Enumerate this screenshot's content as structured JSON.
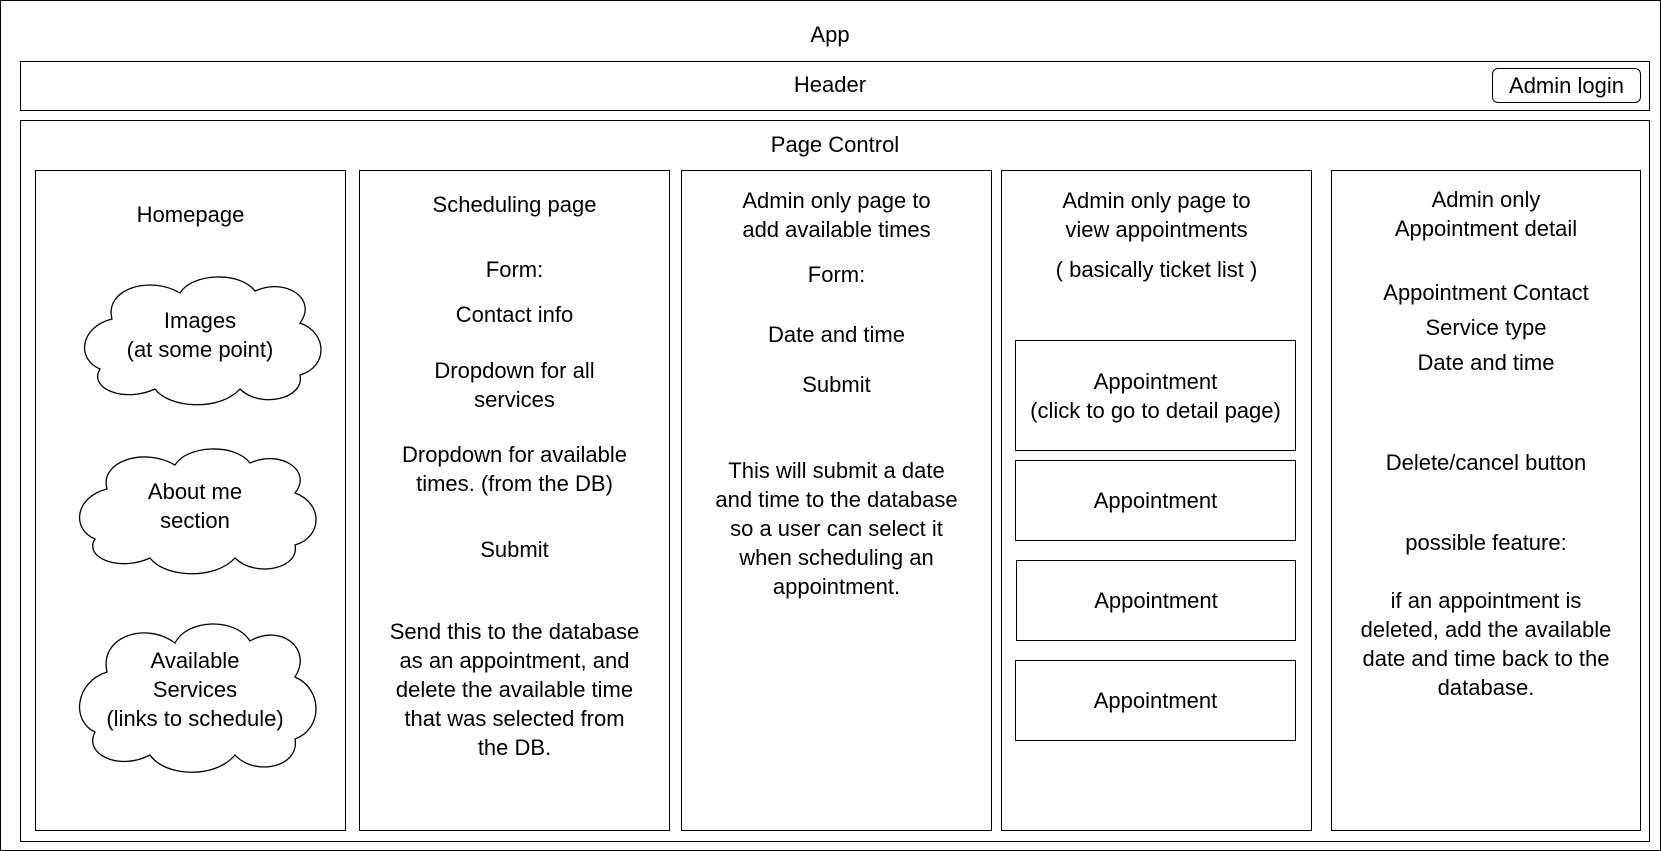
{
  "app": {
    "title": "App"
  },
  "header": {
    "title": "Header",
    "admin_login_label": "Admin login"
  },
  "page_control": {
    "title": "Page Control"
  },
  "homepage": {
    "title": "Homepage",
    "clouds": [
      {
        "label": "Images\n(at some point)"
      },
      {
        "label": "About me\nsection"
      },
      {
        "label": "Available\nServices\n(links to schedule)"
      }
    ]
  },
  "scheduling": {
    "title": "Scheduling page",
    "form_label": "Form:",
    "contact": "Contact info",
    "services_dropdown": "Dropdown for all\nservices",
    "times_dropdown": "Dropdown for available\ntimes. (from the DB)",
    "submit": "Submit",
    "note": "Send this to the database\nas an appointment, and\ndelete the available time\nthat was selected from\nthe DB."
  },
  "admin_add": {
    "title": "Admin only page to\nadd available times",
    "form_label": "Form:",
    "date_time": "Date and time",
    "submit": "Submit",
    "note": "This will submit a date\nand time to the database\nso a user can select it\nwhen scheduling an\nappointment."
  },
  "admin_view": {
    "title": "Admin only page to\nview appointments",
    "subtitle": "( basically ticket list )",
    "appointments": [
      {
        "label": "Appointment\n(click to go to detail page)"
      },
      {
        "label": "Appointment"
      },
      {
        "label": "Appointment"
      },
      {
        "label": "Appointment"
      }
    ]
  },
  "admin_detail": {
    "title": "Admin only\nAppointment detail",
    "contact": "Appointment Contact",
    "service": "Service type",
    "date_time": "Date and time",
    "delete": "Delete/cancel button",
    "feature_label": "possible feature:",
    "feature_note": "if an appointment is\ndeleted, add the available\ndate and time back to the\ndatabase."
  }
}
